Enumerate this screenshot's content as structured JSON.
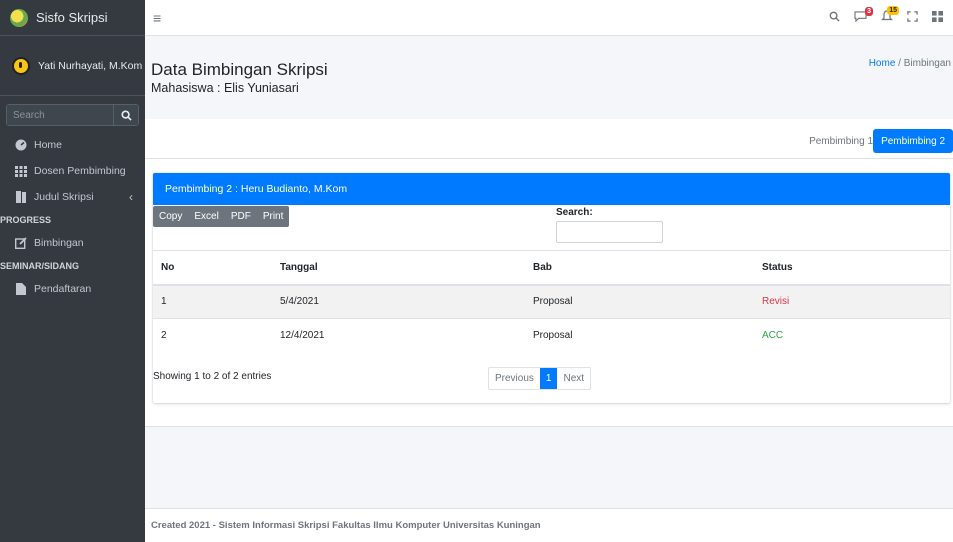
{
  "brand": {
    "name": "Sisfo Skripsi"
  },
  "user": {
    "name": "Yati Nurhayati, M.Kom"
  },
  "sidebar": {
    "search_placeholder": "Search",
    "items": [
      {
        "label": "Home",
        "icon": "dashboard-icon"
      },
      {
        "label": "Dosen Pembimbing",
        "icon": "grid-icon"
      },
      {
        "label": "Judul Skripsi",
        "icon": "book-icon"
      },
      {
        "header": "PROGRESS"
      },
      {
        "label": "Bimbingan",
        "icon": "edit-icon"
      },
      {
        "header": "SEMINAR/SIDANG"
      },
      {
        "label": "Pendaftaran",
        "icon": "file-icon"
      }
    ]
  },
  "topbar": {
    "menu_icon": "hamburger-icon",
    "badge_messages": "3",
    "badge_notifications": "15"
  },
  "header": {
    "title": "Data Bimbingan Skripsi",
    "subtitle": "Mahasiswa : Elis Yuniasari",
    "breadcrumb_home": "Home",
    "breadcrumb_sep": "/",
    "breadcrumb_current": "Bimbingan"
  },
  "tabs": [
    {
      "label": "Pembimbing 1",
      "active": false
    },
    {
      "label": "Pembimbing 2",
      "active": true
    }
  ],
  "card": {
    "title": "Pembimbing 2 : Heru Budianto, M.Kom",
    "buttons": [
      "Copy",
      "Excel",
      "PDF",
      "Print"
    ],
    "search_label": "Search:",
    "columns": [
      "No",
      "Tanggal",
      "Bab",
      "Status"
    ],
    "rows": [
      {
        "no": "1",
        "tanggal": "5/4/2021",
        "bab": "Proposal",
        "status": "Revisi"
      },
      {
        "no": "2",
        "tanggal": "12/4/2021",
        "bab": "Proposal",
        "status": "ACC"
      }
    ],
    "info": "Showing 1 to 2 of 2 entries",
    "pager": {
      "previous": "Previous",
      "current": "1",
      "next": "Next"
    }
  },
  "footer": {
    "text": "Created 2021 - Sistem Informasi Skripsi Fakultas Ilmu Komputer Universitas Kuningan"
  },
  "colors": {
    "primary": "#007bff",
    "sidebar": "#343a40",
    "danger": "#dc3545",
    "success": "#28a745"
  }
}
